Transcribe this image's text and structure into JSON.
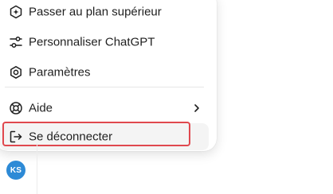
{
  "menu": {
    "items": [
      {
        "label": "Passer au plan supérieur",
        "icon": "upgrade-icon"
      },
      {
        "label": "Personnaliser ChatGPT",
        "icon": "sliders-icon"
      },
      {
        "label": "Paramètres",
        "icon": "gear-icon"
      },
      {
        "label": "Aide",
        "icon": "lifebuoy-icon",
        "submenu_icon": "chevron-right-icon"
      },
      {
        "label": "Se déconnecter",
        "icon": "logout-icon"
      }
    ]
  },
  "user": {
    "initials": "KS",
    "avatar_color": "#2d8ad6"
  },
  "colors": {
    "highlight_border": "#e0484e",
    "hover_background": "#f4f4f4"
  }
}
